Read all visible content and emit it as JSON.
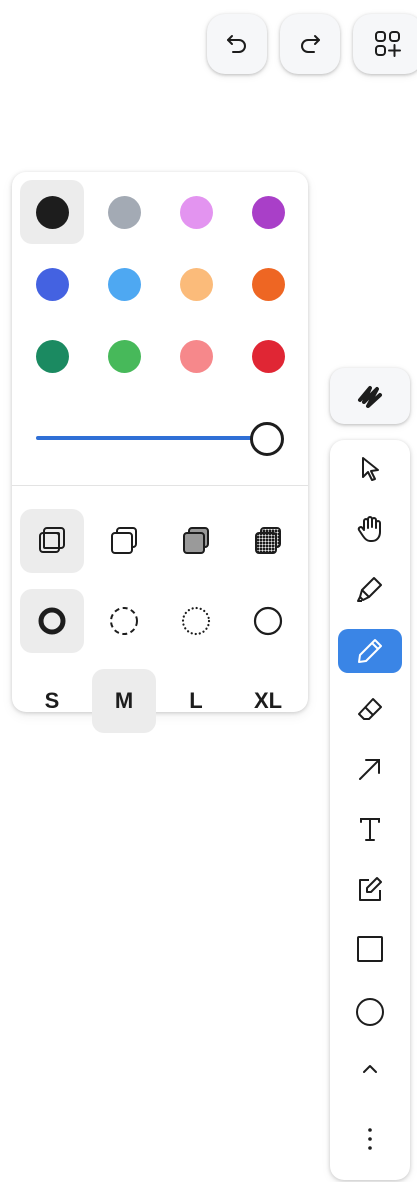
{
  "top_buttons": [
    {
      "icon": "undo-icon"
    },
    {
      "icon": "redo-icon"
    },
    {
      "icon": "add-pages-icon"
    }
  ],
  "style_panel": {
    "colors": [
      {
        "name": "black",
        "hex": "#1d1d1d",
        "selected": true
      },
      {
        "name": "grey",
        "hex": "#a3aab4",
        "selected": false
      },
      {
        "name": "light-violet",
        "hex": "#e394f0",
        "selected": false
      },
      {
        "name": "violet",
        "hex": "#a93fc8",
        "selected": false
      },
      {
        "name": "blue",
        "hex": "#4462e1",
        "selected": false
      },
      {
        "name": "light-blue",
        "hex": "#4ea8f2",
        "selected": false
      },
      {
        "name": "yellow",
        "hex": "#fbbb7a",
        "selected": false
      },
      {
        "name": "orange",
        "hex": "#ee6623",
        "selected": false
      },
      {
        "name": "green",
        "hex": "#1b8a61",
        "selected": false
      },
      {
        "name": "light-green",
        "hex": "#47b95a",
        "selected": false
      },
      {
        "name": "light-red",
        "hex": "#f6888b",
        "selected": false
      },
      {
        "name": "red",
        "hex": "#e02634",
        "selected": false
      }
    ],
    "opacity": 1.0,
    "fills": [
      {
        "name": "fill-none",
        "selected": true
      },
      {
        "name": "fill-semi",
        "selected": false
      },
      {
        "name": "fill-solid",
        "selected": false
      },
      {
        "name": "fill-pattern",
        "selected": false
      }
    ],
    "dashes": [
      {
        "name": "dash-draw",
        "selected": true
      },
      {
        "name": "dash-dashed",
        "selected": false
      },
      {
        "name": "dash-dotted",
        "selected": false
      },
      {
        "name": "dash-solid",
        "selected": false
      }
    ],
    "sizes": [
      {
        "label": "S",
        "selected": false
      },
      {
        "label": "M",
        "selected": true
      },
      {
        "label": "L",
        "selected": false
      },
      {
        "label": "XL",
        "selected": false
      }
    ]
  },
  "quick_style": {
    "icon": "scribble-icon"
  },
  "tools": [
    {
      "name": "select",
      "icon": "pointer-icon",
      "selected": false
    },
    {
      "name": "hand",
      "icon": "hand-icon",
      "selected": false
    },
    {
      "name": "highlight",
      "icon": "highlighter-icon",
      "selected": false
    },
    {
      "name": "draw",
      "icon": "pencil-icon",
      "selected": true
    },
    {
      "name": "eraser",
      "icon": "eraser-icon",
      "selected": false
    },
    {
      "name": "arrow",
      "icon": "arrow-icon",
      "selected": false
    },
    {
      "name": "text",
      "icon": "text-icon",
      "selected": false
    },
    {
      "name": "note",
      "icon": "note-icon",
      "selected": false
    },
    {
      "name": "rectangle",
      "icon": "rectangle-icon",
      "selected": false
    },
    {
      "name": "ellipse",
      "icon": "ellipse-icon",
      "selected": false
    },
    {
      "name": "more-tools",
      "icon": "chevron-up-icon",
      "selected": false
    },
    {
      "name": "menu",
      "icon": "more-vertical-icon",
      "selected": false
    }
  ]
}
